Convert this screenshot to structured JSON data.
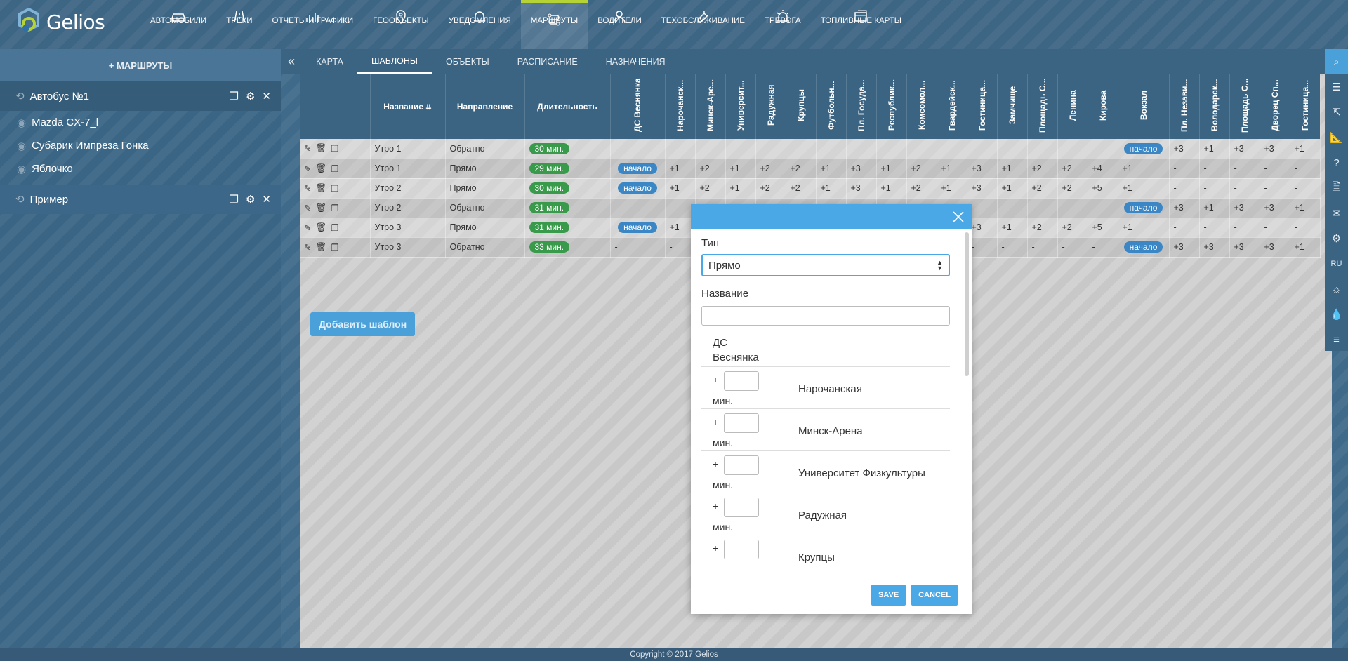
{
  "brand": {
    "name": "Gelios"
  },
  "nav": [
    {
      "label": "АВТОМОБИЛИ",
      "icon": "car-icon"
    },
    {
      "label": "ТРЕКИ",
      "icon": "road-icon"
    },
    {
      "label": "ОТЧЕТЫ И ГРАФИКИ",
      "icon": "chart-icon"
    },
    {
      "label": "ГЕООБЪЕКТЫ",
      "icon": "pin-icon"
    },
    {
      "label": "УВЕДОМЛЕНИЯ",
      "icon": "bell-icon"
    },
    {
      "label": "МАРШРУТЫ",
      "icon": "route-icon",
      "active": true
    },
    {
      "label": "ВОДИТЕЛИ",
      "icon": "user-icon"
    },
    {
      "label": "ТЕХОБСЛУЖИВАНИЕ",
      "icon": "wrench-icon"
    },
    {
      "label": "ТРЕВОГА",
      "icon": "alarm-icon"
    },
    {
      "label": "ТОПЛИВНЫЕ КАРТЫ",
      "icon": "card-icon"
    }
  ],
  "sidebar": {
    "add_label": "+ МАРШРУТЫ",
    "routes": [
      {
        "name": "Автобус №1",
        "objects": [
          "Mazda CX-7_l",
          "Субарик Импреза Гонка",
          "Яблочко"
        ]
      },
      {
        "name": "Пример",
        "objects": []
      }
    ]
  },
  "tabs": [
    "КАРТА",
    "ШАБЛОНЫ",
    "ОБЪЕКТЫ",
    "РАСПИСАНИЕ",
    "НАЗНАЧЕНИЯ"
  ],
  "active_tab": "ШАБЛОНЫ",
  "table": {
    "headers": {
      "name": "Название",
      "direction": "Направление",
      "duration": "Длительность"
    },
    "stops": [
      "ДС Веснянка",
      "Нарочанск...",
      "Минск-Аре...",
      "Университ...",
      "Радужная",
      "Крупцы",
      "Футбольн...",
      "Пл. Госуда...",
      "Республик...",
      "Комсомол...",
      "Гвардейск...",
      "Гостиница...",
      "Замчище",
      "Площадь С...",
      "Ленина",
      "Кирова",
      "Вокзал",
      "Пл. Незави...",
      "Володарск...",
      "Площадь С...",
      "Дворец Сп...",
      "Гостиница..."
    ],
    "rows": [
      {
        "name": "Утро 1",
        "direction": "Обратно",
        "duration": "30 мин.",
        "cells": [
          "-",
          "-",
          "-",
          "-",
          "-",
          "-",
          "-",
          "-",
          "-",
          "-",
          "-",
          "-",
          "-",
          "-",
          "-",
          "-",
          "начало",
          "+3",
          "+1",
          "+3",
          "+3",
          "+1"
        ]
      },
      {
        "name": "Утро 1",
        "direction": "Прямо",
        "duration": "29 мин.",
        "cells": [
          "начало",
          "+1",
          "+2",
          "+1",
          "+2",
          "+2",
          "+1",
          "+3",
          "+1",
          "+2",
          "+1",
          "+3",
          "+1",
          "+2",
          "+2",
          "+4",
          "+1",
          "-",
          "-",
          "-",
          "-",
          "-"
        ]
      },
      {
        "name": "Утро 2",
        "direction": "Прямо",
        "duration": "30 мин.",
        "cells": [
          "начало",
          "+1",
          "+2",
          "+1",
          "+2",
          "+2",
          "+1",
          "+3",
          "+1",
          "+2",
          "+1",
          "+3",
          "+1",
          "+2",
          "+2",
          "+5",
          "+1",
          "-",
          "-",
          "-",
          "-",
          "-"
        ]
      },
      {
        "name": "Утро 2",
        "direction": "Обратно",
        "duration": "31 мин.",
        "cells": [
          "-",
          "-",
          "",
          "",
          "",
          "",
          "",
          "",
          "",
          "",
          "",
          "-",
          "-",
          "-",
          "-",
          "-",
          "начало",
          "+3",
          "+1",
          "+3",
          "+3",
          "+1"
        ]
      },
      {
        "name": "Утро 3",
        "direction": "Прямо",
        "duration": "31 мин.",
        "cells": [
          "начало",
          "+1",
          "",
          "",
          "",
          "",
          "",
          "",
          "",
          "",
          "",
          "+3",
          "+1",
          "+2",
          "+2",
          "+5",
          "+1",
          "-",
          "-",
          "-",
          "-",
          "-"
        ]
      },
      {
        "name": "Утро 3",
        "direction": "Обратно",
        "duration": "33 мин.",
        "cells": [
          "-",
          "-",
          "",
          "",
          "",
          "",
          "",
          "",
          "",
          "",
          "",
          "-",
          "-",
          "-",
          "-",
          "-",
          "начало",
          "+3",
          "+3",
          "+3",
          "+3",
          "+1"
        ]
      }
    ],
    "add_button": "Добавить шаблон"
  },
  "right_bar": [
    "search-icon",
    "menu-icon",
    "share-icon",
    "ruler-icon",
    "help-icon",
    "doc-icon",
    "message-icon",
    "sliders-icon",
    "RU",
    "bulb-icon",
    "drop-icon",
    "list-icon"
  ],
  "modal": {
    "type_label": "Тип",
    "type_value": "Прямо",
    "name_label": "Название",
    "first_stop": "ДС Веснянка",
    "plus": "+",
    "minutes": "мин.",
    "stops": [
      "Нарочанская",
      "Минск-Арена",
      "Университет Физкультуры",
      "Радужная",
      "Крупцы"
    ],
    "save": "SAVE",
    "cancel": "CANCEL"
  },
  "footer": "Copyright © 2017 Gelios"
}
